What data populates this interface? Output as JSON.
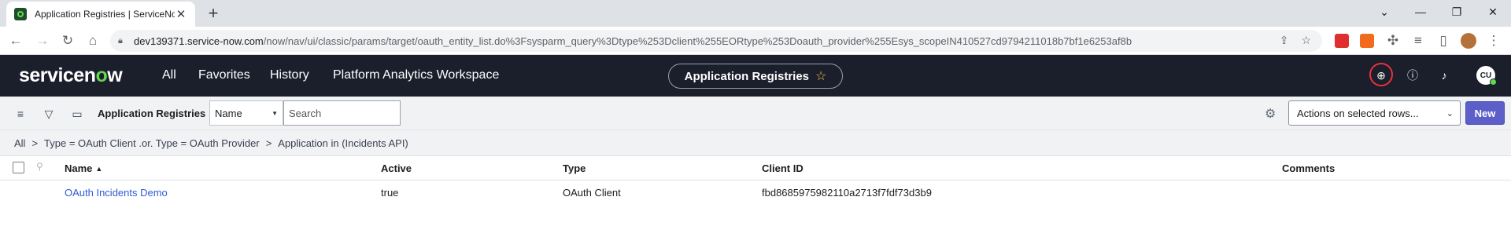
{
  "browser": {
    "tab_title": "Application Registries | ServiceNo",
    "tab_close": "✕",
    "new_tab": "+",
    "url_host": "dev139371.service-now.com",
    "url_path": "/now/nav/ui/classic/params/target/oauth_entity_list.do%3Fsysparm_query%3Dtype%253Dclient%255EORtype%253Doauth_provider%255Esys_scopeIN410527cd9794211018b7bf1e6253af8b"
  },
  "header": {
    "logo_pre": "servicen",
    "logo_o": "o",
    "logo_post": "w",
    "nav": [
      "All",
      "Favorites",
      "History",
      "Platform Analytics Workspace"
    ],
    "context_title": "Application Registries",
    "avatar_initials": "CU"
  },
  "listbar": {
    "title": "Application Registries",
    "field_select": "Name",
    "search_placeholder": "Search",
    "actions_select": "Actions on selected rows...",
    "new_label": "New"
  },
  "breadcrumbs": [
    "All",
    "Type = OAuth Client .or. Type = OAuth Provider",
    "Application in (Incidents API)"
  ],
  "table": {
    "columns": [
      "Name",
      "Active",
      "Type",
      "Client ID",
      "Comments"
    ],
    "rows": [
      {
        "name": "OAuth Incidents Demo",
        "active": "true",
        "type": "OAuth Client",
        "client_id": "fbd8685975982110a2713f7fdf73d3b9",
        "comments": ""
      }
    ]
  },
  "colors": {
    "header_bg": "#1b1e2b",
    "accent_green": "#62d84e",
    "new_button": "#5b5fc7",
    "link": "#2e5bd8"
  }
}
